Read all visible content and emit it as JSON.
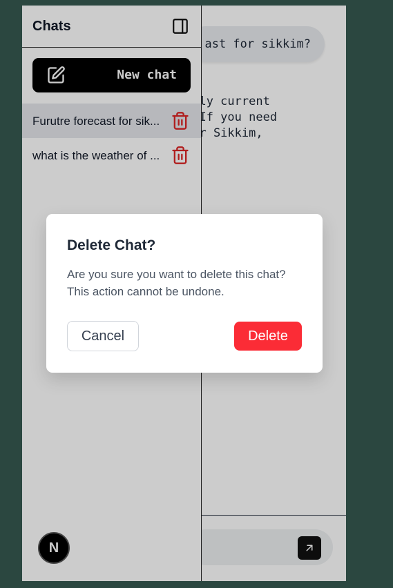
{
  "chat": {
    "user_message": "ast for sikkim?",
    "assistant_lines": [
      " only current",
      ". If you need",
      " for Sikkim,"
    ]
  },
  "sidebar": {
    "title": "Chats",
    "new_chat_label": "New chat",
    "items": [
      {
        "title": "Furutre forecast for sik...",
        "active": true
      },
      {
        "title": "what is the weather of ...",
        "active": false
      }
    ],
    "badge": "N"
  },
  "modal": {
    "title": "Delete Chat?",
    "message": "Are you sure you want to delete this chat? This action cannot be undone.",
    "cancel_label": "Cancel",
    "delete_label": "Delete"
  },
  "icons": {
    "sidebar_toggle": "sidebar-toggle-icon",
    "new_chat": "pencil-square-icon",
    "delete": "trash-icon",
    "send": "arrow-up-right-icon"
  },
  "colors": {
    "background": "#2b4740",
    "danger": "#fb2c36",
    "primary": "#000000"
  }
}
